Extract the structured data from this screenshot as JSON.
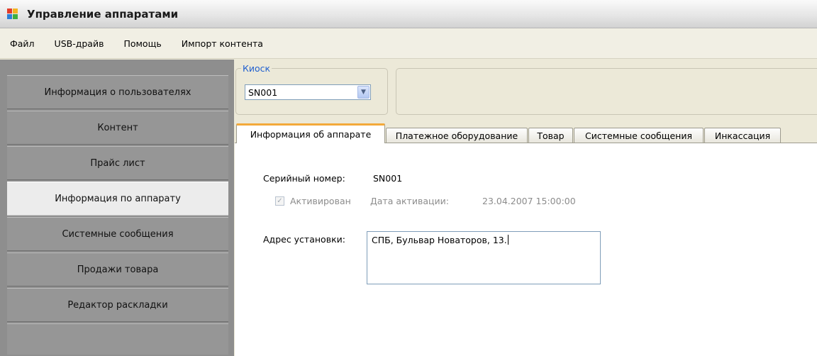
{
  "window": {
    "title": "Управление аппаратами"
  },
  "menu": [
    "Файл",
    "USB-драйв",
    "Помощь",
    "Импорт контента"
  ],
  "sidebar": {
    "items": [
      {
        "label": "Информация о пользователях",
        "active": false
      },
      {
        "label": "Контент",
        "active": false
      },
      {
        "label": "Прайс лист",
        "active": false
      },
      {
        "label": "Информация по аппарату",
        "active": true
      },
      {
        "label": "Системные сообщения",
        "active": false
      },
      {
        "label": "Продажи товара",
        "active": false
      },
      {
        "label": "Редактор раскладки",
        "active": false
      }
    ]
  },
  "kiosk": {
    "legend": "Киоск",
    "selected": "SN001"
  },
  "tabs": [
    {
      "label": "Информация об аппарате",
      "active": true
    },
    {
      "label": "Платежное оборудование",
      "active": false
    },
    {
      "label": "Товар",
      "active": false
    },
    {
      "label": "Системные сообщения",
      "active": false
    },
    {
      "label": "Инкассация",
      "active": false
    }
  ],
  "device_info": {
    "serial_label": "Серийный номер:",
    "serial_value": "SN001",
    "activated_label": "Активирован",
    "activated": true,
    "activation_date_label": "Дата активации:",
    "activation_date_value": "23.04.2007 15:00:00",
    "address_label": "Адрес установки:",
    "address_value": "СПБ, Бульвар Новаторов, 13."
  },
  "colors": {
    "accent_tab": "#f3a93a",
    "legend": "#1f5fcf",
    "sidebar": "#969696"
  }
}
